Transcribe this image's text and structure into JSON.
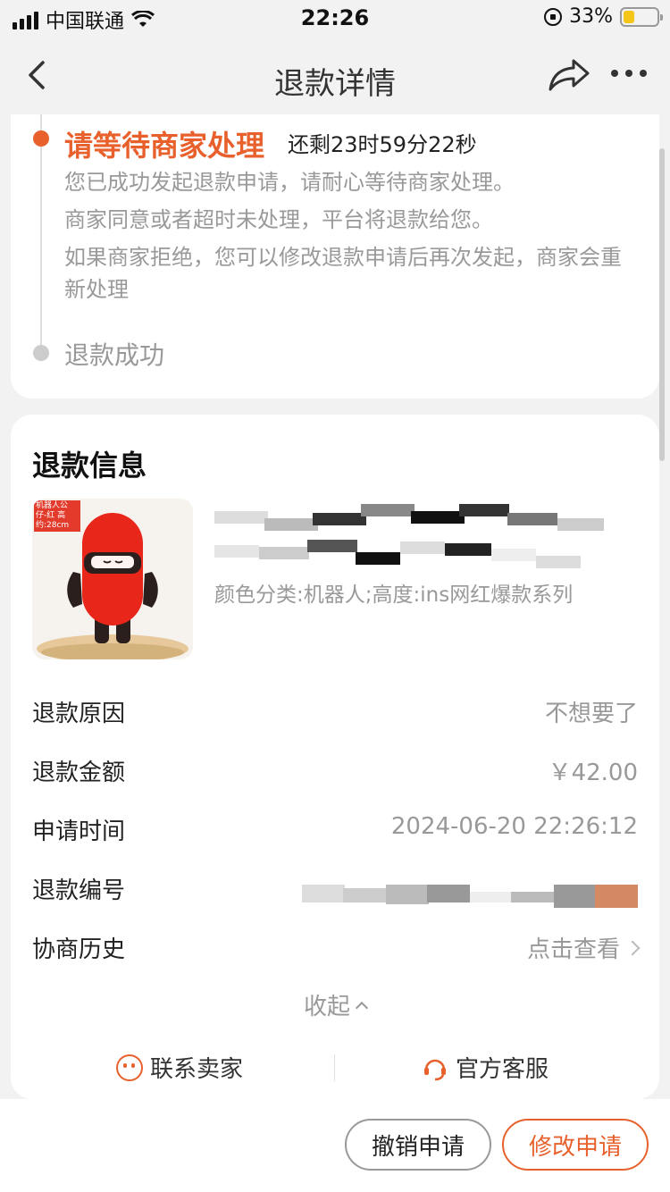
{
  "status_bar": {
    "carrier": "中国联通",
    "time": "22:26",
    "battery": "33%",
    "battery_level": 0.33
  },
  "nav": {
    "title": "退款详情"
  },
  "progress": {
    "current_step": "请等待商家处理",
    "countdown": "还剩23时59分22秒",
    "desc1": "您已成功发起退款申请，请耐心等待商家处理。",
    "desc2": "商家同意或者超时未处理，平台将退款给您。",
    "desc3": "如果商家拒绝，您可以修改退款申请后再次发起，商家会重新处理",
    "next_step": "退款成功"
  },
  "refund_info": {
    "title": "退款信息",
    "product": {
      "image_tag": "机器人公仔-红 高约:28cm",
      "sku": "颜色分类:机器人;高度:ins网红爆款系列"
    },
    "rows": [
      {
        "label": "退款原因",
        "value": "不想要了"
      },
      {
        "label": "退款金额",
        "value": "￥42.00"
      },
      {
        "label": "申请时间",
        "value": "2024-06-20 22:26:12"
      },
      {
        "label": "退款编号",
        "value": ""
      },
      {
        "label": "协商历史",
        "value": "点击查看"
      }
    ],
    "collapse": "收起",
    "contact_seller": "联系卖家",
    "official_service": "官方客服"
  },
  "actions": {
    "cancel": "撤销申请",
    "modify": "修改申请"
  },
  "colors": {
    "accent": "#e8612c",
    "muted": "#999999"
  }
}
